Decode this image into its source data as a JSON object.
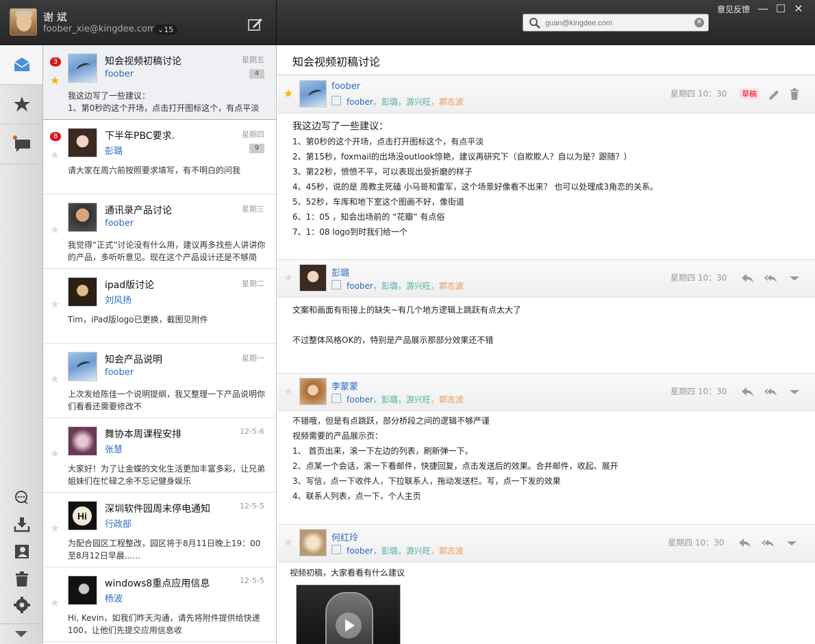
{
  "user": {
    "name": "谢 斌",
    "email": "foober_xie@kingdee.com",
    "count": "15"
  },
  "search": {
    "placeholder": "guan@kingdee.com"
  },
  "window": {
    "feedback": "意见反馈",
    "minimize": "—",
    "maximize": "☐",
    "close": "✕"
  },
  "messages": [
    {
      "subject": "知会视频初稿讨论",
      "sender": "foober",
      "date": "星期五",
      "count": "4",
      "badge": "3",
      "preview": "我这边写了一些建议：\n1、第0秒的这个开场，点击打开图标这个，有点平淡",
      "starred": true,
      "avatar": "bird"
    },
    {
      "subject": "下半年PBC要求.",
      "sender": "彭璐",
      "date": "星期四",
      "count": "9",
      "badge": "8",
      "preview": "请大家在周六前按照要求填写，有不明白的问我",
      "starred": false,
      "avatar": "girl"
    },
    {
      "subject": "通讯录产品讨论",
      "sender": "foober",
      "date": "星期三",
      "preview": "我觉得“正式”讨论没有什么用，建议再多找些人讲讲你的产品，多听听意见。现在这个产品设计还是不够简",
      "starred": false,
      "avatar": "man"
    },
    {
      "subject": "ipad版讨论",
      "sender": "刘风扬",
      "date": "星期二",
      "preview": "Tim，iPad版logo已更换，截图见附件",
      "starred": false,
      "avatar": "long"
    },
    {
      "subject": "知会产品说明",
      "sender": "foober",
      "date": "星期一",
      "preview": "上次发给陈佳一个说明提纲，我又整理一下产品说明你们看看还需要修改不",
      "starred": false,
      "avatar": "bird"
    },
    {
      "subject": "舞协本周课程安排",
      "sender": "张慧",
      "date": "12-5-6",
      "preview": "大家好！为了让金蝶的文化生活更加丰富多彩，让兄弟姐妹们在忙碌之余不忘记健身娱乐",
      "starred": false,
      "avatar": "heart"
    },
    {
      "subject": "深圳软件园周末停电通知",
      "sender": "行政部",
      "date": "12-5-5",
      "preview": "为配合园区工程整改，园区将于8月11日晚上19：00至8月12日早晨......",
      "starred": false,
      "avatar": "hi"
    },
    {
      "subject": "windows8重点应用信息",
      "sender": "杨波",
      "date": "12-5-5",
      "preview": "Hi, Kevin，如我们昨天沟通，请先将附件提供给快递100，让他们先提交应用信息收",
      "starred": false,
      "avatar": "dark"
    }
  ],
  "conversation": {
    "title": "知会视频初稿讨论",
    "recipients": [
      "foober",
      "彭璐",
      "游兴旺",
      "郭志波"
    ],
    "draft_label": "草稿",
    "posts": [
      {
        "from": "foober",
        "time": "星期四 10：30",
        "starred": true,
        "avatar": "bird",
        "lines": [
          "我这边写了一些建议：",
          "1、第0秒的这个开场，点击打开图标这个，有点平淡",
          "2、第15秒，foxmail的出场没outlook惊艳，建议再研究下（自欺欺人？自以为是？跟随？）",
          "3、第22秒，愤愤不平，可以表现出受折磨的样子",
          "4、45秒，说的是 周教主死磕 小马哥和雷军，这个场景好像看不出来？ 也可以处理成3角恋的关系。",
          "5、52秒，车库和地下室这个图画不好，像街道",
          "6、1：05 ，知会出场前的 “花瓣” 有点俗",
          "7、1：08 logo到时我们给一个"
        ]
      },
      {
        "from": "彭璐",
        "time": "星期四 10：30",
        "starred": false,
        "avatar": "girl",
        "lines": [
          "文案和画面有衔接上的缺失~有几个地方逻辑上跳跃有点太大了",
          "",
          "不过整体风格OK的，特别是产品展示那部分效果还不错"
        ]
      },
      {
        "from": "李蒙蒙",
        "time": "星期四 10：30",
        "starred": false,
        "avatar": "lee",
        "lines": [
          "不错哦，但是有点跳跃，部分桥段之间的逻辑不够严谨",
          "视频需要的产品展示页：",
          "1、 首页出来，滚一下左边的列表，刷新弹一下。",
          "2、点某一个会话，滚一下看邮件，快捷回复，点击发送后的效果。合并邮件，收起、展开",
          "3、写信，点一下收件人，下拉联系人，拖动发送栏。写，点一下发的效果",
          "4、联系人列表，点一下，个人主页"
        ]
      },
      {
        "from": "何红玲",
        "time": "星期四 10：30",
        "starred": false,
        "avatar": "anime",
        "lines": [
          "视频初稿，大家看看有什么建议"
        ]
      }
    ]
  }
}
